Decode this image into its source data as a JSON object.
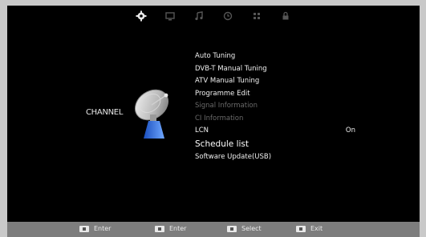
{
  "top_tabs": [
    {
      "icon": "gear-icon",
      "active": true
    },
    {
      "icon": "monitor-icon",
      "active": false
    },
    {
      "icon": "music-note-icon",
      "active": false
    },
    {
      "icon": "clock-icon",
      "active": false
    },
    {
      "icon": "grid-icon",
      "active": false
    },
    {
      "icon": "lock-icon",
      "active": false
    }
  ],
  "section": {
    "title": "CHANNEL",
    "icon": "satellite-dish-icon"
  },
  "menu": {
    "items": [
      {
        "label": "Auto Tuning",
        "value": "",
        "state": "normal"
      },
      {
        "label": "DVB-T Manual Tuning",
        "value": "",
        "state": "normal"
      },
      {
        "label": "ATV Manual Tuning",
        "value": "",
        "state": "normal"
      },
      {
        "label": "Programme Edit",
        "value": "",
        "state": "normal"
      },
      {
        "label": "Signal Information",
        "value": "",
        "state": "disabled"
      },
      {
        "label": "CI Information",
        "value": "",
        "state": "disabled"
      },
      {
        "label": "LCN",
        "value": "On",
        "state": "normal"
      },
      {
        "label": "Schedule list",
        "value": "",
        "state": "selected"
      },
      {
        "label": "Software Update(USB)",
        "value": "",
        "state": "normal"
      }
    ]
  },
  "hints": [
    {
      "key": "ok-key-icon",
      "label": "Enter"
    },
    {
      "key": "menu-key-icon",
      "label": "Enter"
    },
    {
      "key": "arrow-key-icon",
      "label": "Select"
    },
    {
      "key": "exit-key-icon",
      "label": "Exit"
    }
  ],
  "colors": {
    "background": "#000000",
    "bottom_bar": "#7d7d7d",
    "disabled_text": "#6a6a6a"
  }
}
